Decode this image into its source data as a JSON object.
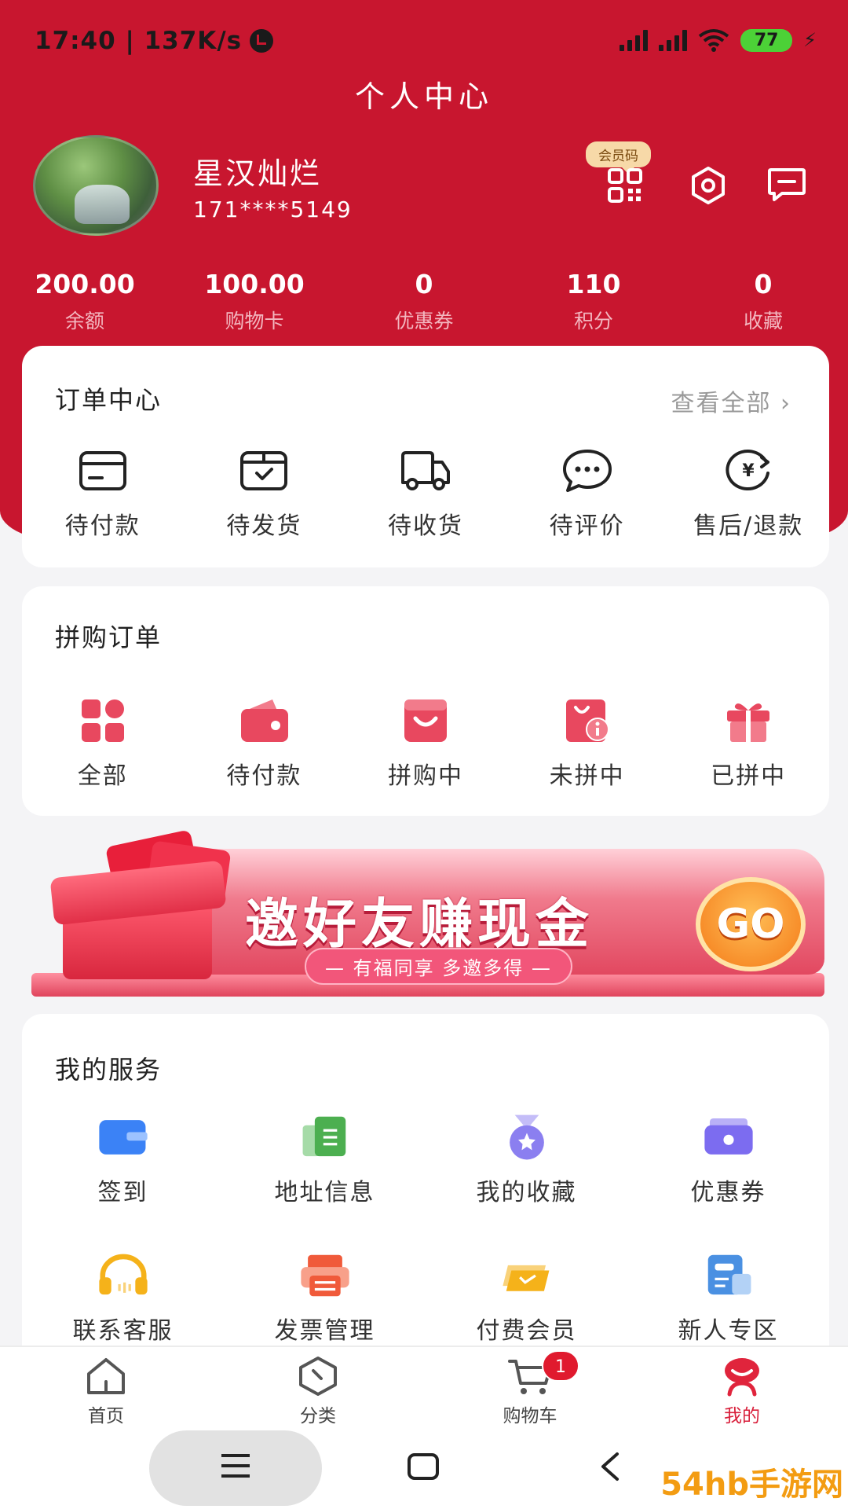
{
  "status_bar": {
    "time": "17:40 | 137K/s",
    "battery": "77"
  },
  "header": {
    "title": "个人中心"
  },
  "profile": {
    "name": "星汉灿烂",
    "phone": "171****5149",
    "member_code_label": "会员码"
  },
  "stats": [
    {
      "value": "200.00",
      "label": "余额"
    },
    {
      "value": "100.00",
      "label": "购物卡"
    },
    {
      "value": "0",
      "label": "优惠券"
    },
    {
      "value": "110",
      "label": "积分"
    },
    {
      "value": "0",
      "label": "收藏"
    }
  ],
  "order_center": {
    "title": "订单中心",
    "view_all": "查看全部 ›",
    "items": [
      {
        "label": "待付款",
        "icon": "card-icon"
      },
      {
        "label": "待发货",
        "icon": "package-icon"
      },
      {
        "label": "待收货",
        "icon": "truck-icon"
      },
      {
        "label": "待评价",
        "icon": "comment-icon"
      },
      {
        "label": "售后/退款",
        "icon": "refund-icon"
      }
    ]
  },
  "group_orders": {
    "title": "拼购订单",
    "items": [
      {
        "label": "全部",
        "icon": "grid-icon"
      },
      {
        "label": "待付款",
        "icon": "wallet-icon"
      },
      {
        "label": "拼购中",
        "icon": "bag-icon"
      },
      {
        "label": "未拼中",
        "icon": "info-tag-icon"
      },
      {
        "label": "已拼中",
        "icon": "gift-icon"
      }
    ]
  },
  "banner": {
    "headline": "邀好友赚现金",
    "subline": "— 有福同享 多邀多得 —",
    "go": "GO"
  },
  "services": {
    "title": "我的服务",
    "items": [
      {
        "label": "签到",
        "icon": "checkin-card-icon",
        "color": "#3b82f6"
      },
      {
        "label": "地址信息",
        "icon": "address-book-icon",
        "color": "#4caf50"
      },
      {
        "label": "我的收藏",
        "icon": "star-medal-icon",
        "color": "#8b7ff0"
      },
      {
        "label": "优惠券",
        "icon": "coupon-wallet-icon",
        "color": "#7c6cf0"
      },
      {
        "label": "联系客服",
        "icon": "headset-icon",
        "color": "#f5b21a"
      },
      {
        "label": "发票管理",
        "icon": "invoice-icon",
        "color": "#f05a3a"
      },
      {
        "label": "付费会员",
        "icon": "vip-ticket-icon",
        "color": "#f5b21a"
      },
      {
        "label": "新人专区",
        "icon": "newcomer-icon",
        "color": "#4a90e2"
      }
    ]
  },
  "bottom_nav": {
    "items": [
      {
        "label": "首页",
        "icon": "home-icon"
      },
      {
        "label": "分类",
        "icon": "category-icon"
      },
      {
        "label": "购物车",
        "icon": "cart-icon",
        "badge": "1"
      },
      {
        "label": "我的",
        "icon": "profile-icon"
      }
    ]
  },
  "colors": {
    "brand_red": "#c8162f",
    "active_red": "#d81e3a"
  },
  "watermark": "54hb手游网"
}
